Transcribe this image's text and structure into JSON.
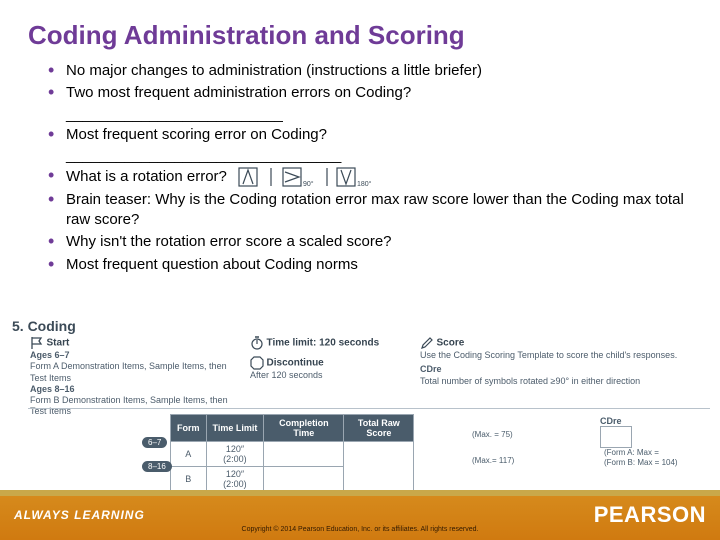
{
  "title": "Coding Administration and Scoring",
  "bullets": {
    "b0": "No major changes to administration (instructions a little briefer)",
    "b1": "Two most frequent administration errors on Coding?",
    "blank1": "__________________________",
    "b2": "Most frequent scoring error on Coding?",
    "blank2": "_________________________________",
    "b3": "What is a rotation error?",
    "b4": "Brain teaser: Why is the Coding rotation error max raw score lower than the Coding max total raw score?",
    "b5": "Why isn't the rotation error score a scaled score?",
    "b6": "Most frequent question about Coding norms"
  },
  "rotation_angles": {
    "a90": "90°",
    "a180": "180°"
  },
  "sheet": {
    "heading": "5. Coding",
    "start_hdr": "Start",
    "start_l1": "Ages 6–7",
    "start_l2": "Form A Demonstration Items, Sample Items, then Test Items",
    "start_l3": "Ages 8–16",
    "start_l4": "Form B Demonstration Items, Sample Items, then Test Items",
    "time_hdr": "Time limit: 120 seconds",
    "disc_hdr": "Discontinue",
    "disc_l1": "After 120 seconds",
    "score_hdr": "Score",
    "score_l1": "Use the Coding Scoring Template to score the child's responses.",
    "score_l2": "CDre",
    "score_l3": "Total number of symbols rotated ≥90° in either direction"
  },
  "table": {
    "h_form": "Form",
    "h_time": "Time Limit",
    "h_comp": "Completion Time",
    "h_total": "Total Raw Score",
    "age_a": "6–7",
    "form_a": "A",
    "time_a1": "120″",
    "time_a2": "(2:00)",
    "age_b": "8–16",
    "form_b": "B",
    "time_b1": "120″",
    "time_b2": "(2:00)",
    "max_a": "(Max. = 75)",
    "max_b": "(Max.= 117)",
    "cdre_label": "CDre",
    "cdre_a": "(Form A: Max = ",
    "cdre_b": "(Form B: Max = 104)"
  },
  "footer": {
    "tagline": "ALWAYS LEARNING",
    "brand": "PEARSON",
    "copy": "Copyright © 2014 Pearson Education, Inc. or its affiliates. All rights reserved."
  }
}
